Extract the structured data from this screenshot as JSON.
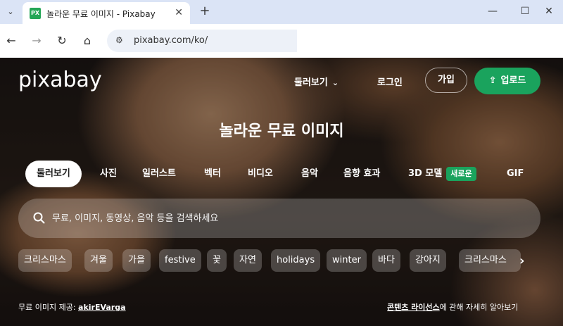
{
  "browser": {
    "tab_title": "놀라운 무료 이미지 - Pixabay",
    "favicon_text": "PX",
    "url": "pixabay.com/ko/",
    "icons": [
      "chevron-down-icon",
      "close-icon",
      "plus-icon",
      "minimize-icon",
      "maximize-icon",
      "close-window-icon",
      "back-icon",
      "forward-icon",
      "reload-icon",
      "home-icon",
      "site-info-icon"
    ]
  },
  "header": {
    "logo": "pixabay",
    "explore": "둘러보기",
    "login": "로그인",
    "signup": "가입",
    "upload": "업로드"
  },
  "hero": {
    "headline": "놀라운 무료 이미지",
    "categories": [
      "둘러보기",
      "사진",
      "일러스트",
      "벡터",
      "비디오",
      "음악",
      "음향 효과",
      "3D 모델",
      "GIF"
    ],
    "new_badge": "새로운",
    "search_placeholder": "무료, 이미지, 동영상, 음악 등을 검색하세요",
    "tags": [
      "크리스마스",
      "겨울",
      "가을",
      "festive",
      "꽃",
      "자연",
      "holidays",
      "winter",
      "바다",
      "강아지",
      "크리스마스"
    ],
    "credit_prefix": "무료 이미지 제공:",
    "credit_author": "akirEVarga",
    "license_link": "콘텐츠 라이선스",
    "license_suffix": "에 관해 자세히 알아보기"
  },
  "colors": {
    "accent_green": "#1aa35d",
    "tabbar": "#dbe4f6"
  }
}
